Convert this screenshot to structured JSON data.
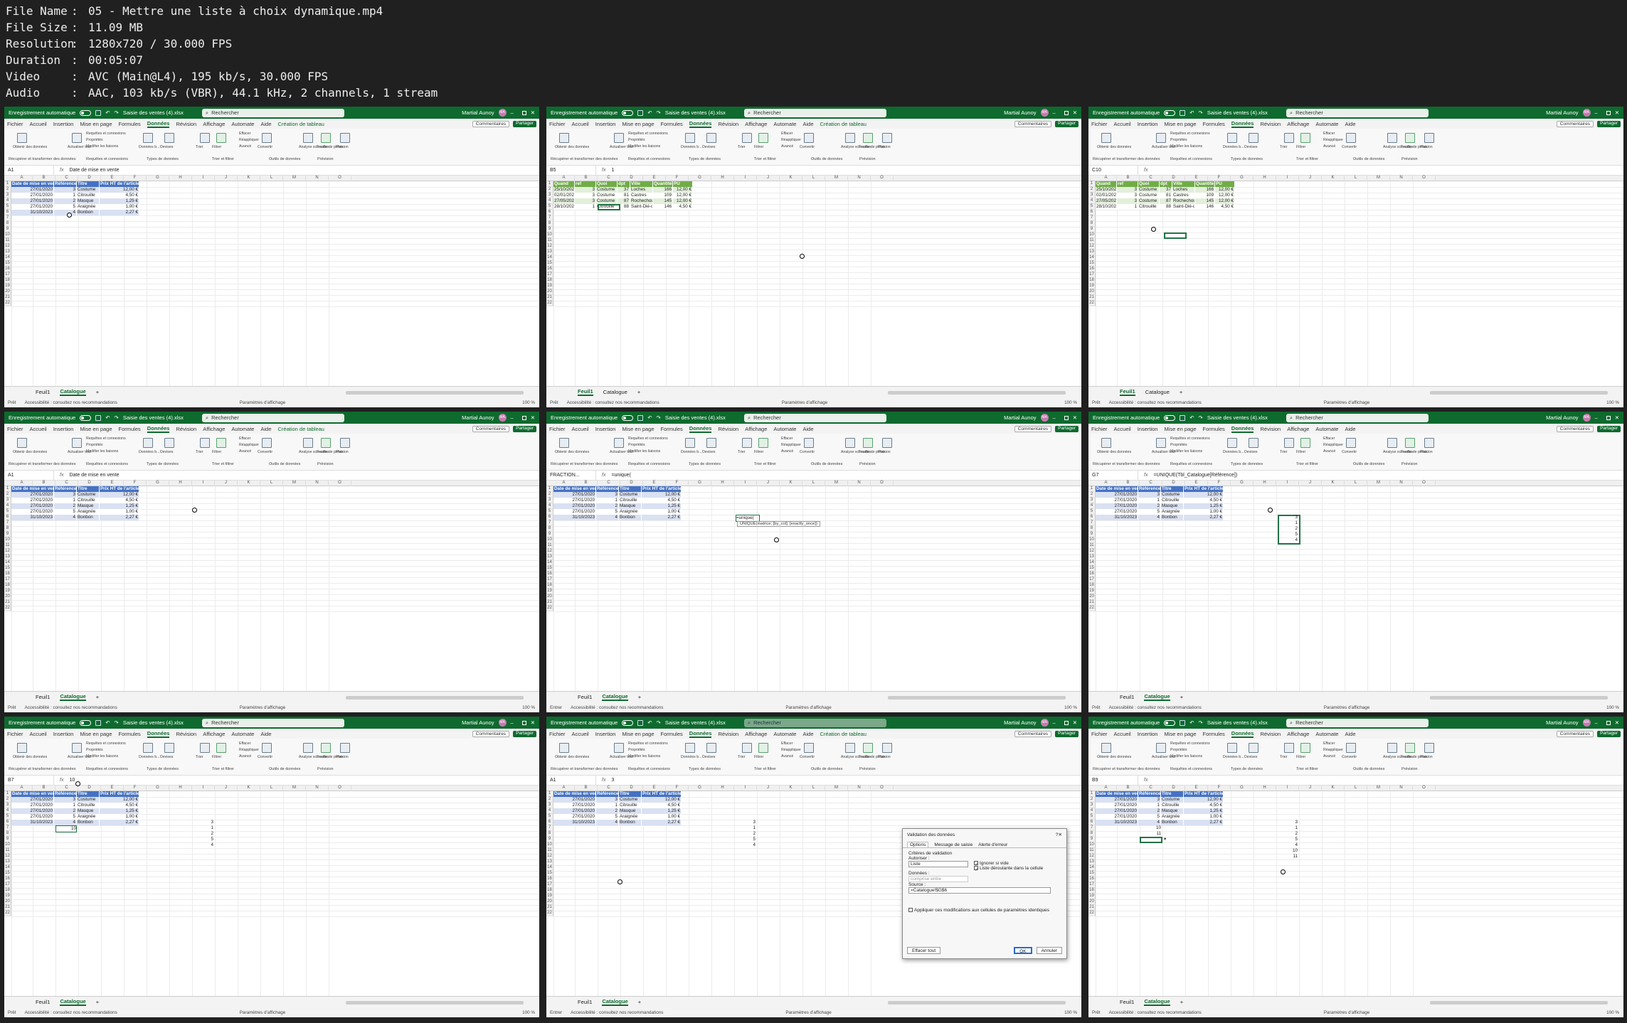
{
  "header": {
    "fields": [
      {
        "label": "File Name",
        "value": "05 - Mettre une liste à choix dynamique.mp4"
      },
      {
        "label": "File Size",
        "value": "11.09 MB"
      },
      {
        "label": "Resolution",
        "value": "1280x720 / 30.000 FPS"
      },
      {
        "label": "Duration",
        "value": "00:05:07"
      },
      {
        "label": "Video",
        "value": "AVC (Main@L4), 195 kb/s, 30.000 FPS"
      },
      {
        "label": "Audio",
        "value": "AAC, 103 kb/s (VBR), 44.1 kHz, 2 channels, 1 stream"
      }
    ]
  },
  "excel": {
    "autosave": "Enregistrement automatique",
    "filename": "Saisie des ventes (4).xlsx",
    "search": "Rechercher",
    "user": "Martial Aunoy",
    "initials": "MA",
    "menu": [
      "Fichier",
      "Accueil",
      "Insertion",
      "Mise en page",
      "Formules",
      "Données",
      "Révision",
      "Affichage",
      "Automate",
      "Aide"
    ],
    "context_tab": "Création de tableau",
    "comments": "Commentaires",
    "share": "Partager",
    "ribbon": {
      "get_data": "Obtenir des données",
      "refresh": "Actualiser tout",
      "queries": "Requêtes et connexions",
      "properties": "Propriétés",
      "edit_links": "Modifier les liaisons",
      "stocks": "Données b...",
      "currencies": "Devises",
      "sort": "Trier",
      "filter": "Filtrer",
      "clear": "Effacer",
      "reapply": "Réappliquer",
      "advanced": "Avancé",
      "convert": "Convertir",
      "whatif": "Analyse scénarios",
      "forecast": "Feuille de prévision",
      "outline": "Plan",
      "groups": [
        "Récupérer et transformer des données",
        "Requêtes et connexions",
        "Types de données",
        "Trier et filtrer",
        "Outils de données",
        "Prévision"
      ]
    },
    "sheets": [
      "Feuil1",
      "Catalogue"
    ],
    "add_sheet": "+",
    "status_ready": "Prêt",
    "status_enter": "Entrer",
    "accessibility": "Accessibilité : consultez nos recommandations",
    "display_settings": "Paramètres d'affichage",
    "zoom": "100 %"
  },
  "columns": [
    "A",
    "B",
    "C",
    "D",
    "E",
    "F",
    "G",
    "H",
    "I",
    "J",
    "K",
    "L",
    "M",
    "N",
    "O"
  ],
  "catalogue": {
    "headers": [
      "Date de mise en vente",
      "Référence",
      "Titre",
      "Prix HT de l'article"
    ],
    "rows": [
      [
        "27/01/2020",
        "3",
        "Costume",
        "12,00 €"
      ],
      [
        "27/01/2020",
        "1",
        "Citrouille",
        "4,50 €"
      ],
      [
        "27/01/2020",
        "2",
        "Masque",
        "1,25 €"
      ],
      [
        "27/01/2020",
        "5",
        "Araignée",
        "1,00 €"
      ],
      [
        "31/10/2023",
        "4",
        "Bonbon",
        "2,27 €"
      ]
    ]
  },
  "feuil1": {
    "headers": [
      "Quand",
      "ref",
      "Quoi",
      "dpt",
      "Ville",
      "Quantité",
      "PU"
    ],
    "rows": [
      [
        "25/10/2022",
        "3",
        "Costume",
        "37",
        "Loches",
        "166",
        "12,00 €"
      ],
      [
        "02/01/2023",
        "3",
        "Costume",
        "81",
        "Castres",
        "109",
        "12,00 €"
      ],
      [
        "27/05/2023",
        "3",
        "Costume",
        "87",
        "Rochechouart",
        "145",
        "12,00 €"
      ],
      [
        "28/10/2023",
        "1",
        "Citrouille",
        "88",
        "Saint-Dié-de",
        "146",
        "4,50 €"
      ]
    ]
  },
  "panels": [
    {
      "name_box": "A1",
      "formula": "Date de mise en vente",
      "active_sheet": "Catalogue",
      "status": "Prêt",
      "show_context": true
    },
    {
      "name_box": "B5",
      "formula": "1",
      "active_sheet": "Feuil1",
      "status": "Prêt",
      "show_context": true
    },
    {
      "name_box": "C10",
      "formula": "",
      "active_sheet": "Feuil1",
      "status": "Prêt",
      "show_context": false
    },
    {
      "name_box": "A1",
      "formula": "Date de mise en vente",
      "active_sheet": "Catalogue",
      "status": "Prêt",
      "show_context": true
    },
    {
      "name_box": "FRACTION...",
      "formula": "=unique(",
      "active_sheet": "Catalogue",
      "status": "Entrer",
      "show_context": false
    },
    {
      "name_box": "G7",
      "formula": "=UNIQUE(Tbl_Catalogue[Référence])",
      "active_sheet": "Catalogue",
      "status": "Prêt",
      "show_context": false
    },
    {
      "name_box": "B7",
      "formula": "10",
      "active_sheet": "Catalogue",
      "status": "Prêt",
      "show_context": false
    },
    {
      "name_box": "A1",
      "formula": "3",
      "active_sheet": "Catalogue",
      "status": "Entrer",
      "show_context": true
    },
    {
      "name_box": "B9",
      "formula": "",
      "active_sheet": "Catalogue",
      "status": "Prêt",
      "show_context": false
    }
  ],
  "extras": {
    "unique_typing": "=unique(",
    "unique_tooltip": "UNIQUE(matrice; [by_col]; [exactly_once])",
    "spill_values": [
      "3",
      "1",
      "2",
      "5",
      "4"
    ],
    "typed_ref": "10",
    "new_refs": [
      "10",
      "11"
    ],
    "last_panel_list": [
      "3",
      "1",
      "2",
      "5",
      "4",
      "10",
      "11"
    ]
  },
  "dialog": {
    "title": "Validation des données",
    "help": "?",
    "close": "✕",
    "tabs": [
      "Options",
      "Message de saisie",
      "Alerte d'erreur"
    ],
    "criteria": "Critères de validation",
    "allow_label": "Autoriser :",
    "allow_value": "Liste",
    "ignore_blank": "Ignorer si vide",
    "dropdown": "Liste déroulante dans la cellule",
    "data_label": "Données :",
    "data_value": "comprise entre",
    "source_label": "Source :",
    "source_value": "=Catalogue!$G$6",
    "apply_all": "Appliquer ces modifications aux cellules de paramètres identiques",
    "clear_all": "Effacer tout",
    "ok": "OK",
    "cancel": "Annuler"
  }
}
